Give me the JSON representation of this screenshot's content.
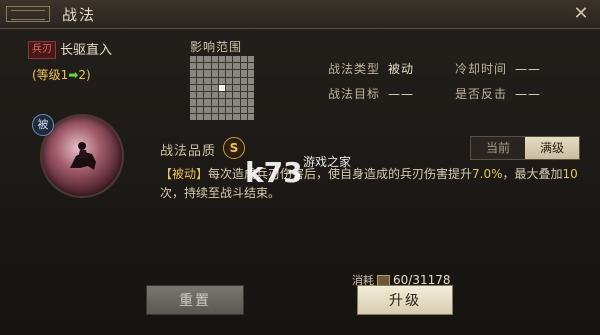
{
  "window": {
    "title": "战法",
    "close_glyph": "✕"
  },
  "skill": {
    "category_tag": "兵刃",
    "name": "长驱直入",
    "level_prefix": "(等级1",
    "level_arrow": "➡",
    "level_suffix": "2)",
    "portrait_badge": "被"
  },
  "range": {
    "label": "影响范围"
  },
  "info": {
    "type_label": "战法类型",
    "type_value": "被动",
    "target_label": "战法目标",
    "target_value": "——",
    "cooldown_label": "冷却时间",
    "cooldown_value": "——",
    "counter_label": "是否反击",
    "counter_value": "——"
  },
  "quality": {
    "label": "战法品质",
    "grade": "S"
  },
  "tabs": [
    {
      "label": "当前",
      "active": false
    },
    {
      "label": "满级",
      "active": true
    }
  ],
  "description": {
    "keyword": "【被动】",
    "text1": "每次造成兵刃伤害后，使自身造成的兵刃伤害提升",
    "value1": "7.0%",
    "text2": "，最大叠加",
    "value2": "10",
    "text3": "次，持续至战斗结束。"
  },
  "watermark": {
    "logo": "k73",
    "sub": "游戏之家"
  },
  "cost": {
    "label": "消耗",
    "value": "60/31178"
  },
  "buttons": {
    "reset": "重置",
    "upgrade": "升级"
  }
}
